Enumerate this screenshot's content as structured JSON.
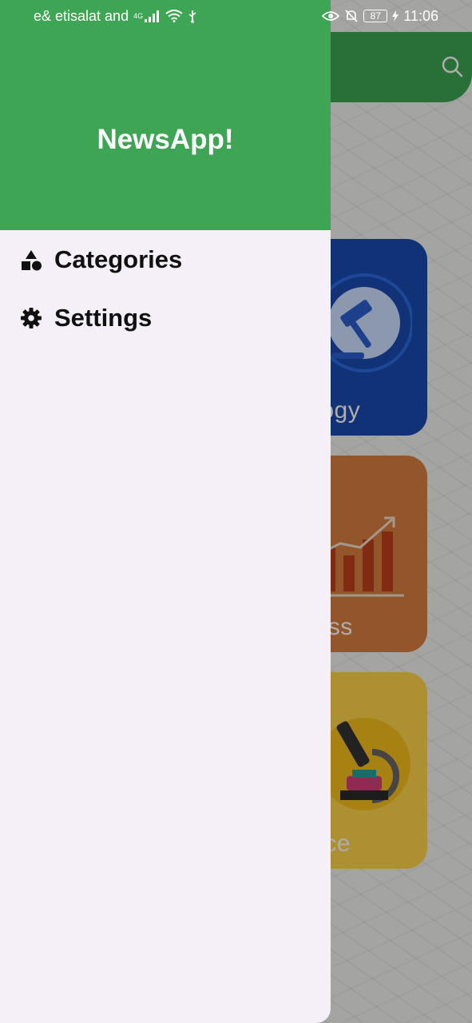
{
  "status_bar": {
    "carrier": "e& etisalat and",
    "network": "4G",
    "battery": "87",
    "time": "11:06"
  },
  "drawer": {
    "title": "NewsApp!",
    "items": [
      {
        "label": "Categories",
        "icon": "shapes-icon"
      },
      {
        "label": "Settings",
        "icon": "gear-icon"
      }
    ]
  },
  "background": {
    "cards": [
      {
        "label_visible": "nology",
        "color": "#1b4ab0"
      },
      {
        "label_visible": "iness",
        "color": "#d97f3e"
      },
      {
        "label_visible": "ence",
        "color": "#ffd54a"
      }
    ]
  },
  "colors": {
    "primary": "#3da553",
    "drawer_bg": "#f5f0f8"
  }
}
